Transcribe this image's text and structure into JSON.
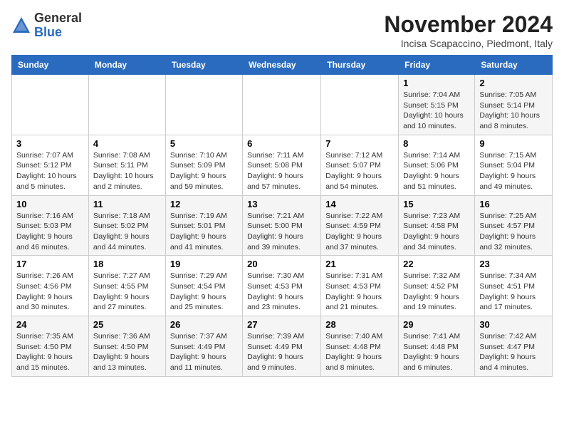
{
  "header": {
    "logo_general": "General",
    "logo_blue": "Blue",
    "month_title": "November 2024",
    "location": "Incisa Scapaccino, Piedmont, Italy"
  },
  "days_of_week": [
    "Sunday",
    "Monday",
    "Tuesday",
    "Wednesday",
    "Thursday",
    "Friday",
    "Saturday"
  ],
  "weeks": [
    [
      {
        "day": "",
        "info": ""
      },
      {
        "day": "",
        "info": ""
      },
      {
        "day": "",
        "info": ""
      },
      {
        "day": "",
        "info": ""
      },
      {
        "day": "",
        "info": ""
      },
      {
        "day": "1",
        "info": "Sunrise: 7:04 AM\nSunset: 5:15 PM\nDaylight: 10 hours and 10 minutes."
      },
      {
        "day": "2",
        "info": "Sunrise: 7:05 AM\nSunset: 5:14 PM\nDaylight: 10 hours and 8 minutes."
      }
    ],
    [
      {
        "day": "3",
        "info": "Sunrise: 7:07 AM\nSunset: 5:12 PM\nDaylight: 10 hours and 5 minutes."
      },
      {
        "day": "4",
        "info": "Sunrise: 7:08 AM\nSunset: 5:11 PM\nDaylight: 10 hours and 2 minutes."
      },
      {
        "day": "5",
        "info": "Sunrise: 7:10 AM\nSunset: 5:09 PM\nDaylight: 9 hours and 59 minutes."
      },
      {
        "day": "6",
        "info": "Sunrise: 7:11 AM\nSunset: 5:08 PM\nDaylight: 9 hours and 57 minutes."
      },
      {
        "day": "7",
        "info": "Sunrise: 7:12 AM\nSunset: 5:07 PM\nDaylight: 9 hours and 54 minutes."
      },
      {
        "day": "8",
        "info": "Sunrise: 7:14 AM\nSunset: 5:06 PM\nDaylight: 9 hours and 51 minutes."
      },
      {
        "day": "9",
        "info": "Sunrise: 7:15 AM\nSunset: 5:04 PM\nDaylight: 9 hours and 49 minutes."
      }
    ],
    [
      {
        "day": "10",
        "info": "Sunrise: 7:16 AM\nSunset: 5:03 PM\nDaylight: 9 hours and 46 minutes."
      },
      {
        "day": "11",
        "info": "Sunrise: 7:18 AM\nSunset: 5:02 PM\nDaylight: 9 hours and 44 minutes."
      },
      {
        "day": "12",
        "info": "Sunrise: 7:19 AM\nSunset: 5:01 PM\nDaylight: 9 hours and 41 minutes."
      },
      {
        "day": "13",
        "info": "Sunrise: 7:21 AM\nSunset: 5:00 PM\nDaylight: 9 hours and 39 minutes."
      },
      {
        "day": "14",
        "info": "Sunrise: 7:22 AM\nSunset: 4:59 PM\nDaylight: 9 hours and 37 minutes."
      },
      {
        "day": "15",
        "info": "Sunrise: 7:23 AM\nSunset: 4:58 PM\nDaylight: 9 hours and 34 minutes."
      },
      {
        "day": "16",
        "info": "Sunrise: 7:25 AM\nSunset: 4:57 PM\nDaylight: 9 hours and 32 minutes."
      }
    ],
    [
      {
        "day": "17",
        "info": "Sunrise: 7:26 AM\nSunset: 4:56 PM\nDaylight: 9 hours and 30 minutes."
      },
      {
        "day": "18",
        "info": "Sunrise: 7:27 AM\nSunset: 4:55 PM\nDaylight: 9 hours and 27 minutes."
      },
      {
        "day": "19",
        "info": "Sunrise: 7:29 AM\nSunset: 4:54 PM\nDaylight: 9 hours and 25 minutes."
      },
      {
        "day": "20",
        "info": "Sunrise: 7:30 AM\nSunset: 4:53 PM\nDaylight: 9 hours and 23 minutes."
      },
      {
        "day": "21",
        "info": "Sunrise: 7:31 AM\nSunset: 4:53 PM\nDaylight: 9 hours and 21 minutes."
      },
      {
        "day": "22",
        "info": "Sunrise: 7:32 AM\nSunset: 4:52 PM\nDaylight: 9 hours and 19 minutes."
      },
      {
        "day": "23",
        "info": "Sunrise: 7:34 AM\nSunset: 4:51 PM\nDaylight: 9 hours and 17 minutes."
      }
    ],
    [
      {
        "day": "24",
        "info": "Sunrise: 7:35 AM\nSunset: 4:50 PM\nDaylight: 9 hours and 15 minutes."
      },
      {
        "day": "25",
        "info": "Sunrise: 7:36 AM\nSunset: 4:50 PM\nDaylight: 9 hours and 13 minutes."
      },
      {
        "day": "26",
        "info": "Sunrise: 7:37 AM\nSunset: 4:49 PM\nDaylight: 9 hours and 11 minutes."
      },
      {
        "day": "27",
        "info": "Sunrise: 7:39 AM\nSunset: 4:49 PM\nDaylight: 9 hours and 9 minutes."
      },
      {
        "day": "28",
        "info": "Sunrise: 7:40 AM\nSunset: 4:48 PM\nDaylight: 9 hours and 8 minutes."
      },
      {
        "day": "29",
        "info": "Sunrise: 7:41 AM\nSunset: 4:48 PM\nDaylight: 9 hours and 6 minutes."
      },
      {
        "day": "30",
        "info": "Sunrise: 7:42 AM\nSunset: 4:47 PM\nDaylight: 9 hours and 4 minutes."
      }
    ]
  ]
}
